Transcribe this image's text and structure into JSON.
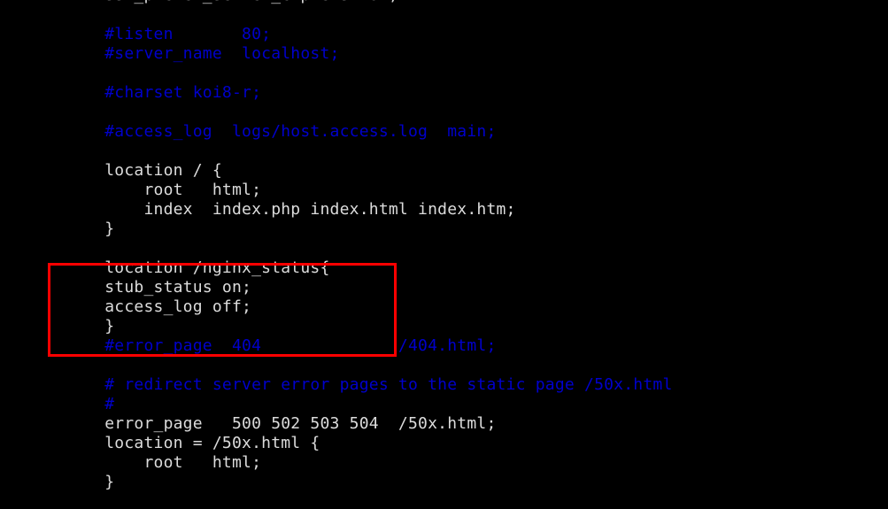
{
  "editor": {
    "background_color": "#000000",
    "default_text_color": "#dcdcdc",
    "comment_color": "#0000cc",
    "annotation_color": "#ff0000",
    "font_size_px": 18,
    "line_height_px": 22
  },
  "code": {
    "language": "nginx",
    "lines": [
      {
        "text": "    ssl_prefer_server_ciphers  on;",
        "kind": "plain"
      },
      {
        "text": "",
        "kind": "blank"
      },
      {
        "text": "    #listen       80;",
        "kind": "comment"
      },
      {
        "text": "    #server_name  localhost;",
        "kind": "comment"
      },
      {
        "text": "",
        "kind": "blank"
      },
      {
        "text": "    #charset koi8-r;",
        "kind": "comment"
      },
      {
        "text": "",
        "kind": "blank"
      },
      {
        "text": "    #access_log  logs/host.access.log  main;",
        "kind": "comment"
      },
      {
        "text": "",
        "kind": "blank"
      },
      {
        "text": "    location / {",
        "kind": "plain"
      },
      {
        "text": "        root   html;",
        "kind": "plain"
      },
      {
        "text": "        index  index.php index.html index.htm;",
        "kind": "plain"
      },
      {
        "text": "    }",
        "kind": "plain"
      },
      {
        "text": "",
        "kind": "blank"
      },
      {
        "text": "    location /nginx_status{",
        "kind": "plain"
      },
      {
        "text": "    stub_status on;",
        "kind": "plain"
      },
      {
        "text": "    access_log off;",
        "kind": "plain"
      },
      {
        "text": "    }",
        "kind": "plain"
      },
      {
        "text": "    #error_page  404              /404.html;",
        "kind": "comment"
      },
      {
        "text": "",
        "kind": "blank"
      },
      {
        "text": "    # redirect server error pages to the static page /50x.html",
        "kind": "comment"
      },
      {
        "text": "    #",
        "kind": "comment"
      },
      {
        "text": "    error_page   500 502 503 504  /50x.html;",
        "kind": "plain"
      },
      {
        "text": "    location = /50x.html {",
        "kind": "plain"
      },
      {
        "text": "        root   html;",
        "kind": "plain"
      },
      {
        "text": "    }",
        "kind": "plain"
      }
    ]
  },
  "annotation": {
    "shape": "rectangle",
    "color": "#ff0000",
    "stroke_width_px": 3,
    "highlighted_lines": [
      "location /nginx_status{",
      "stub_status on;",
      "access_log off;",
      "}"
    ]
  }
}
